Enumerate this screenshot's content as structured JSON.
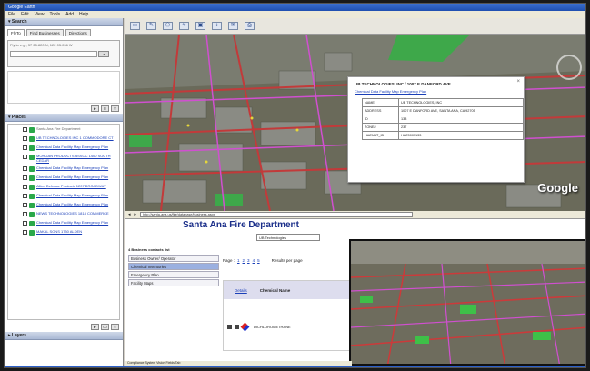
{
  "window": {
    "title": "Google Earth"
  },
  "menu": [
    "File",
    "Edit",
    "View",
    "Tools",
    "Add",
    "Help"
  ],
  "sidebar": {
    "search_title": "Search",
    "tabs": [
      "FlyTo",
      "Find Businesses",
      "Directions"
    ],
    "search_hint": "Fly to e.g., 37 25.820 N, 122 05.036 W",
    "places_title": "Places",
    "layers_title": "Layers",
    "places": [
      {
        "text": "Santa Ana Fire Department",
        "link": false
      },
      {
        "text": "UB TECHNOLOGIES INC 1 COMMODORE CT",
        "link": true
      },
      {
        "text": "Chemical Data Facility Map Emergency Plan",
        "link": true
      },
      {
        "text": "MORGAN PRODUCTS ASSOC 1400 SOUTH CEDAR",
        "link": true
      },
      {
        "text": "Chemical Data Facility Map Emergency Plan",
        "link": true
      },
      {
        "text": "Chemical Data Facility Map Emergency Plan",
        "link": true
      },
      {
        "text": "Allied Defense Products 1207 BROADWAY",
        "link": true
      },
      {
        "text": "Chemical Data Facility Map Emergency Plan",
        "link": true
      },
      {
        "text": "Chemical Data Facility Map Emergency Plan",
        "link": true
      },
      {
        "text": "NEWS TECHNOLOGIES 1818 COMMERCE",
        "link": true
      },
      {
        "text": "Chemical Data Facility Map Emergency Plan",
        "link": true
      },
      {
        "text": "MAKAL SONS 1730 ALDEN",
        "link": true
      }
    ]
  },
  "balloon": {
    "title": "UB TECHNOLOGIES, INC / 1007 E DANFORD AVE",
    "link": "Chemical Data Facility Map Emergency Plan",
    "rows": [
      {
        "label": "NAME",
        "value": "UB TECHNOLOGIES, INC"
      },
      {
        "label": "ADDRESS",
        "value": "1007 E DANFORD AVE, SANTA ANA, CA 92705"
      },
      {
        "label": "ID",
        "value": "133"
      },
      {
        "label": "ZONE#",
        "value": "237"
      },
      {
        "label": "HAZMAT_ID",
        "value": "HAZ0007133"
      }
    ]
  },
  "browser": {
    "address": "http://santa-ana.us/fire/database/business.aspx",
    "page_title": "Santa Ana Fire Department",
    "search_value": "UB Technologies",
    "left_heading": "4 Business contacts list",
    "left_items": [
      "Business Owner/ Operator",
      "Chemical Inventories",
      "Emergency Plan",
      "Facility Maps"
    ],
    "selected_item": 1,
    "pager_label": "Page :",
    "pages": [
      "1",
      "2",
      "3",
      "4",
      "5"
    ],
    "results_text": "Results per page",
    "grid_link": "Details",
    "grid_col": "Chemical Name",
    "grid_row": "DICHLOROMETHANE"
  },
  "statusbar": "Compliance System Vision Fields Tab",
  "map": {
    "watermark": "Google"
  },
  "colors": {
    "accent_link": "#1a3fb8",
    "titlebar": "#1f4fb0",
    "page_title": "#1b2f8a"
  }
}
